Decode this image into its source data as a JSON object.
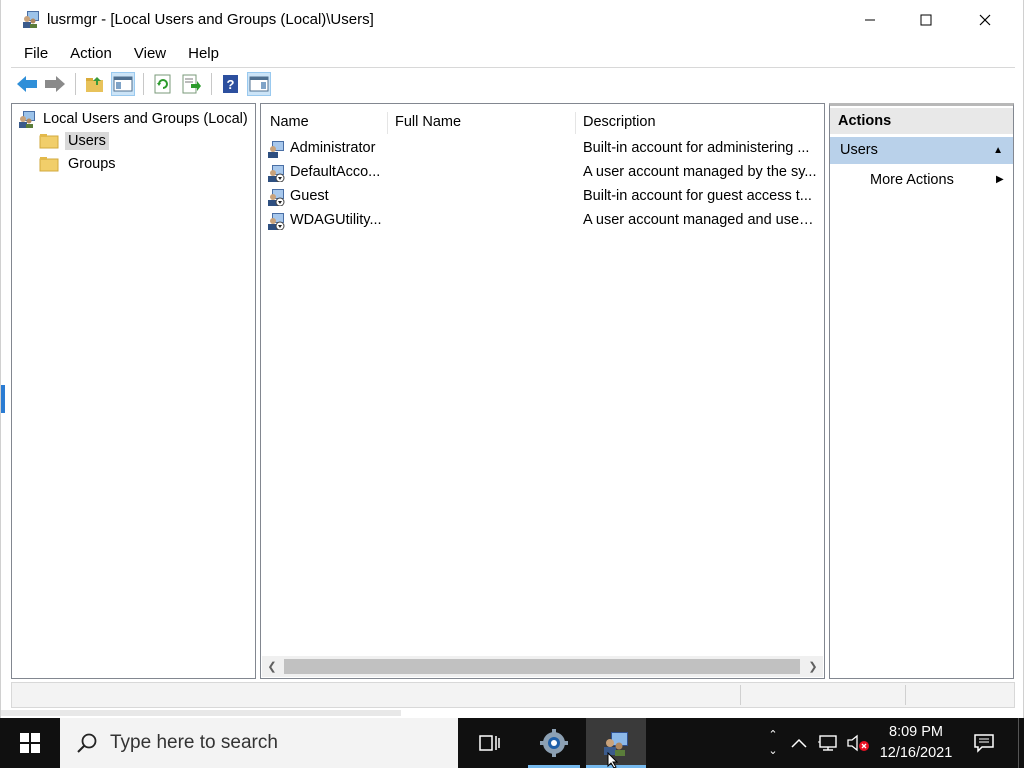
{
  "window": {
    "title": "lusrmgr - [Local Users and Groups (Local)\\Users]",
    "minimize_icon": "minimize-icon",
    "maximize_icon": "maximize-icon",
    "close_icon": "close-icon"
  },
  "menu": {
    "file": "File",
    "action": "Action",
    "view": "View",
    "help": "Help"
  },
  "toolbar": {
    "icons": [
      "back-arrow-icon",
      "forward-arrow-icon",
      "up-folder-icon",
      "show-hide-console-tree-icon",
      "refresh-icon",
      "export-list-icon",
      "help-icon",
      "show-hide-action-pane-icon"
    ]
  },
  "tree": {
    "root": "Local Users and Groups (Local)",
    "items": [
      {
        "label": "Users",
        "selected": true
      },
      {
        "label": "Groups",
        "selected": false
      }
    ]
  },
  "list": {
    "columns": [
      "Name",
      "Full Name",
      "Description"
    ],
    "rows": [
      {
        "name": "Administrator",
        "full_name": "",
        "description": "Built-in account for administering ..."
      },
      {
        "name": "DefaultAcco...",
        "full_name": "",
        "description": "A user account managed by the sy..."
      },
      {
        "name": "Guest",
        "full_name": "",
        "description": "Built-in account for guest access t..."
      },
      {
        "name": "WDAGUtility...",
        "full_name": "",
        "description": "A user account managed and used..."
      }
    ]
  },
  "actions": {
    "title": "Actions",
    "section": "Users",
    "more": "More Actions"
  },
  "taskbar": {
    "search_placeholder": "Type here to search",
    "time": "8:09 PM",
    "date": "12/16/2021",
    "accent": "#76b9ed"
  }
}
